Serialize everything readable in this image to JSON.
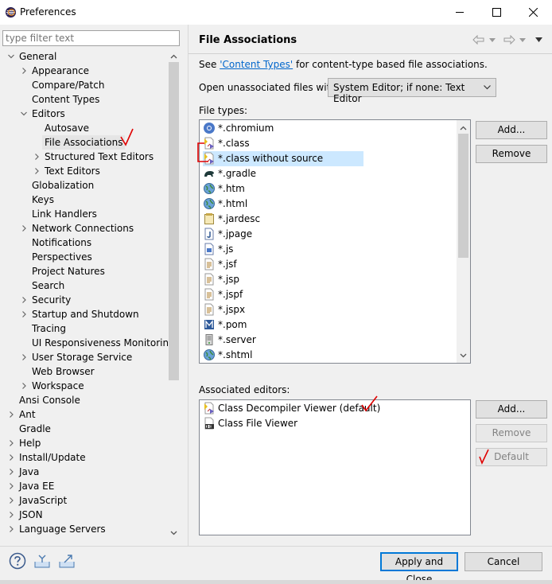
{
  "window": {
    "title": "Preferences"
  },
  "left": {
    "filter_placeholder": "type filter text",
    "tree": [
      {
        "label": "General",
        "twisty": "expanded",
        "indent": 0
      },
      {
        "label": "Appearance",
        "twisty": "collapsed",
        "indent": 1
      },
      {
        "label": "Compare/Patch",
        "twisty": "none",
        "indent": 1
      },
      {
        "label": "Content Types",
        "twisty": "none",
        "indent": 1
      },
      {
        "label": "Editors",
        "twisty": "expanded",
        "indent": 1
      },
      {
        "label": "Autosave",
        "twisty": "none",
        "indent": 2
      },
      {
        "label": "File Associations",
        "twisty": "none",
        "indent": 2,
        "selected": true
      },
      {
        "label": "Structured Text Editors",
        "twisty": "collapsed",
        "indent": 2
      },
      {
        "label": "Text Editors",
        "twisty": "collapsed",
        "indent": 2
      },
      {
        "label": "Globalization",
        "twisty": "none",
        "indent": 1
      },
      {
        "label": "Keys",
        "twisty": "none",
        "indent": 1
      },
      {
        "label": "Link Handlers",
        "twisty": "none",
        "indent": 1
      },
      {
        "label": "Network Connections",
        "twisty": "collapsed",
        "indent": 1
      },
      {
        "label": "Notifications",
        "twisty": "none",
        "indent": 1
      },
      {
        "label": "Perspectives",
        "twisty": "none",
        "indent": 1
      },
      {
        "label": "Project Natures",
        "twisty": "none",
        "indent": 1
      },
      {
        "label": "Search",
        "twisty": "none",
        "indent": 1
      },
      {
        "label": "Security",
        "twisty": "collapsed",
        "indent": 1
      },
      {
        "label": "Startup and Shutdown",
        "twisty": "collapsed",
        "indent": 1
      },
      {
        "label": "Tracing",
        "twisty": "none",
        "indent": 1
      },
      {
        "label": "UI Responsiveness Monitoring",
        "twisty": "none",
        "indent": 1
      },
      {
        "label": "User Storage Service",
        "twisty": "collapsed",
        "indent": 1
      },
      {
        "label": "Web Browser",
        "twisty": "none",
        "indent": 1
      },
      {
        "label": "Workspace",
        "twisty": "collapsed",
        "indent": 1
      },
      {
        "label": "Ansi Console",
        "twisty": "none",
        "indent": 0
      },
      {
        "label": "Ant",
        "twisty": "collapsed",
        "indent": 0
      },
      {
        "label": "Gradle",
        "twisty": "none",
        "indent": 0
      },
      {
        "label": "Help",
        "twisty": "collapsed",
        "indent": 0
      },
      {
        "label": "Install/Update",
        "twisty": "collapsed",
        "indent": 0
      },
      {
        "label": "Java",
        "twisty": "collapsed",
        "indent": 0
      },
      {
        "label": "Java EE",
        "twisty": "collapsed",
        "indent": 0
      },
      {
        "label": "JavaScript",
        "twisty": "collapsed",
        "indent": 0
      },
      {
        "label": "JSON",
        "twisty": "collapsed",
        "indent": 0
      },
      {
        "label": "Language Servers",
        "twisty": "collapsed",
        "indent": 0
      }
    ]
  },
  "page": {
    "title": "File Associations",
    "see_prefix": "See ",
    "see_link": "'Content Types'",
    "see_suffix": " for content-type based file associations.",
    "open_label": "Open unassociated files with:",
    "open_value": "System Editor; if none: Text Editor",
    "file_types_label": "File types:",
    "file_types": [
      {
        "label": "*.chromium",
        "icon": "chromium-icon"
      },
      {
        "label": "*.class",
        "icon": "class-file-icon"
      },
      {
        "label": "*.class without source",
        "icon": "class-file-icon",
        "selected": true
      },
      {
        "label": "*.gradle",
        "icon": "gradle-icon"
      },
      {
        "label": "*.htm",
        "icon": "globe-icon"
      },
      {
        "label": "*.html",
        "icon": "globe-icon"
      },
      {
        "label": "*.jardesc",
        "icon": "jar-icon"
      },
      {
        "label": "*.jpage",
        "icon": "jpage-icon"
      },
      {
        "label": "*.js",
        "icon": "js-file-icon"
      },
      {
        "label": "*.jsf",
        "icon": "text-file-icon"
      },
      {
        "label": "*.jsp",
        "icon": "text-file-icon"
      },
      {
        "label": "*.jspf",
        "icon": "text-file-icon"
      },
      {
        "label": "*.jspx",
        "icon": "text-file-icon"
      },
      {
        "label": "*.pom",
        "icon": "maven-icon"
      },
      {
        "label": "*.server",
        "icon": "server-icon"
      },
      {
        "label": "*.shtml",
        "icon": "globe-icon"
      }
    ],
    "file_types_buttons": {
      "add": "Add...",
      "remove": "Remove"
    },
    "editors_label": "Associated editors:",
    "editors": [
      {
        "label": "Class Decompiler Viewer (default)",
        "icon": "class-file-icon"
      },
      {
        "label": "Class File Viewer",
        "icon": "binary-file-icon"
      }
    ],
    "editors_buttons": {
      "add": "Add...",
      "remove": "Remove",
      "default": "Default"
    }
  },
  "footer": {
    "apply_close": "Apply and Close",
    "cancel": "Cancel"
  },
  "colors": {
    "selection": "#cce8ff",
    "link": "#0066cc",
    "annotation": "#e00000"
  }
}
